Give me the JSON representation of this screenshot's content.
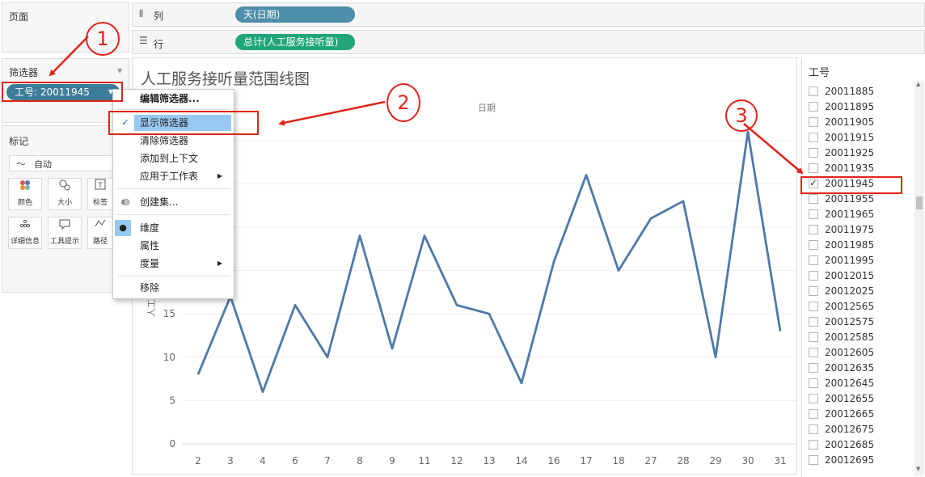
{
  "left_panel": {
    "pages_title": "页面",
    "filters_title": "筛选器",
    "filter_pill": "工号: 20011945",
    "marks_title": "标记",
    "mark_type": "自动",
    "mark_buttons": [
      {
        "label": "颜色",
        "icon": "color-icon"
      },
      {
        "label": "大小",
        "icon": "size-icon"
      },
      {
        "label": "标签",
        "icon": "label-icon"
      },
      {
        "label": "详细信息",
        "icon": "detail-icon"
      },
      {
        "label": "工具提示",
        "icon": "tooltip-icon"
      },
      {
        "label": "路径",
        "icon": "path-icon"
      }
    ]
  },
  "shelves": {
    "columns_label": "列",
    "columns_pill": "天(日期)",
    "rows_label": "行",
    "rows_pill": "总计(人工服务接听量)"
  },
  "context_menu": {
    "items": [
      {
        "label": "编辑筛选器...",
        "bold": true
      },
      {
        "label": "显示筛选器",
        "checked": true,
        "highlighted": true
      },
      {
        "label": "清除筛选器"
      },
      {
        "label": "添加到上下文"
      },
      {
        "label": "应用于工作表",
        "submenu": true
      },
      {
        "label": "创建集...",
        "icon": "set-icon"
      },
      {
        "label": "维度",
        "selected": true
      },
      {
        "label": "属性"
      },
      {
        "label": "度量",
        "submenu": true
      },
      {
        "label": "移除"
      }
    ]
  },
  "chart_data": {
    "type": "line",
    "title": "人工服务接听量范围线图",
    "xlabel": "日期",
    "ylabel": "人工",
    "categories": [
      "2",
      "3",
      "4",
      "6",
      "7",
      "8",
      "9",
      "11",
      "12",
      "13",
      "14",
      "16",
      "17",
      "18",
      "27",
      "28",
      "29",
      "30",
      "31"
    ],
    "values": [
      8,
      17,
      6,
      16,
      10,
      24,
      11,
      24,
      16,
      15,
      7,
      21,
      31,
      20,
      26,
      28,
      10,
      36,
      13
    ],
    "y_ticks": [
      0,
      5,
      10,
      15
    ],
    "ylim": [
      0,
      36
    ],
    "line_color": "#4e79a7",
    "grid": true
  },
  "filter_card": {
    "title": "工号",
    "items": [
      {
        "label": "20011885",
        "checked": false
      },
      {
        "label": "20011895",
        "checked": false
      },
      {
        "label": "20011905",
        "checked": false
      },
      {
        "label": "20011915",
        "checked": false
      },
      {
        "label": "20011925",
        "checked": false
      },
      {
        "label": "20011935",
        "checked": false
      },
      {
        "label": "20011945",
        "checked": true
      },
      {
        "label": "20011955",
        "checked": false
      },
      {
        "label": "20011965",
        "checked": false
      },
      {
        "label": "20011975",
        "checked": false
      },
      {
        "label": "20011985",
        "checked": false
      },
      {
        "label": "20011995",
        "checked": false
      },
      {
        "label": "20012015",
        "checked": false
      },
      {
        "label": "20012025",
        "checked": false
      },
      {
        "label": "20012565",
        "checked": false
      },
      {
        "label": "20012575",
        "checked": false
      },
      {
        "label": "20012585",
        "checked": false
      },
      {
        "label": "20012605",
        "checked": false
      },
      {
        "label": "20012635",
        "checked": false
      },
      {
        "label": "20012645",
        "checked": false
      },
      {
        "label": "20012655",
        "checked": false
      },
      {
        "label": "20012665",
        "checked": false
      },
      {
        "label": "20012675",
        "checked": false
      },
      {
        "label": "20012685",
        "checked": false
      },
      {
        "label": "20012695",
        "checked": false
      }
    ]
  },
  "annotations": {
    "callouts": [
      "1",
      "2",
      "3"
    ],
    "color": "#e0241b"
  },
  "colors": {
    "filter_pill": "#3d7d9c",
    "columns_pill": "#4d8ea9",
    "rows_pill": "#21a67a",
    "menu_highlight": "#99c9f2"
  }
}
